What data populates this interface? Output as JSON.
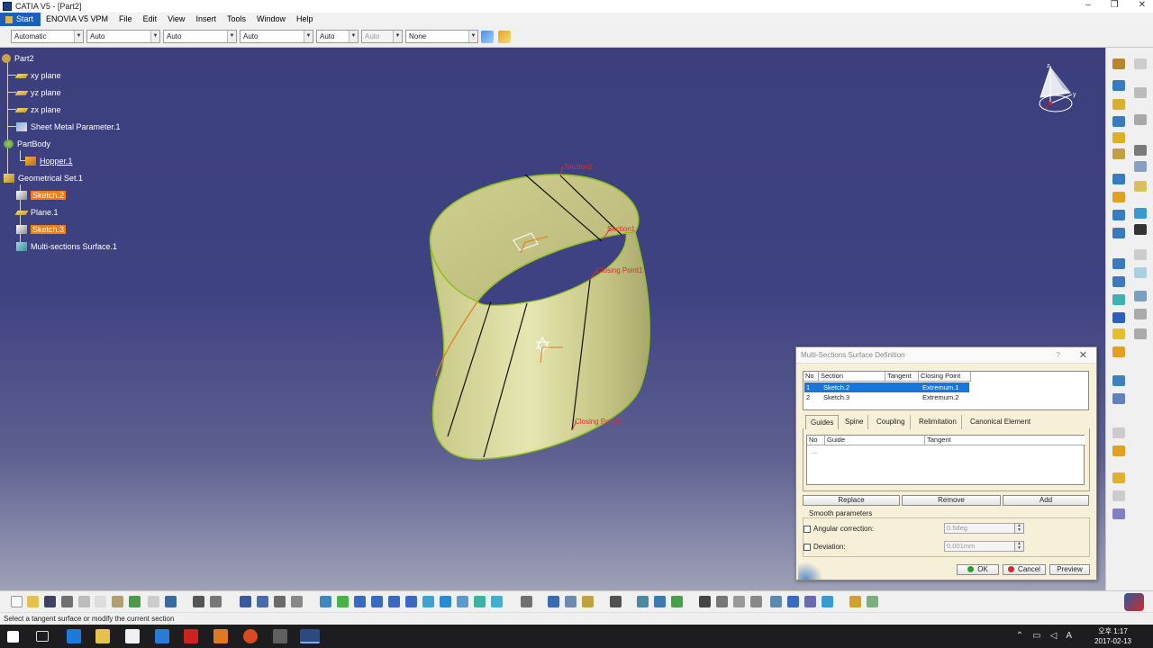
{
  "window": {
    "title": "CATIA V5 - [Part2]",
    "minimize": "–",
    "restore": "❐",
    "close": "✕"
  },
  "menu": [
    "Start",
    "ENOVIA V5 VPM",
    "File",
    "Edit",
    "View",
    "Insert",
    "Tools",
    "Window",
    "Help"
  ],
  "properties": {
    "combo1": "Automatic",
    "combo2": "Auto",
    "combo3": "Auto",
    "combo4": "Auto",
    "combo5": "Auto",
    "combo6": "Auto",
    "combo7": "None"
  },
  "tree": {
    "root": "Part2",
    "xy": "xy plane",
    "yz": "yz plane",
    "zx": "zx plane",
    "sheet": "Sheet Metal Parameter.1",
    "partbody": "PartBody",
    "hopper": "Hopper.1",
    "geoset": "Geometrical Set.1",
    "sketch2": "Sketch.2",
    "plane1": "Plane.1",
    "sketch3": "Sketch.3",
    "surface": "Multi-sections Surface.1"
  },
  "annotations": {
    "section2": "Section2",
    "section1": "Section1",
    "closing1": "Closing Point1",
    "closing2": "Closing Point2"
  },
  "compass": {
    "z": "z",
    "y": "y",
    "x": "x"
  },
  "dialog": {
    "title": "Multi-Sections Surface Definition",
    "help": "?",
    "close": "✕",
    "sections_headers": [
      "No",
      "Section",
      "Tangent",
      "Closing Point"
    ],
    "sections": [
      {
        "no": "1",
        "section": "Sketch.2",
        "closing": "Extremum.1"
      },
      {
        "no": "2",
        "section": "Sketch.3",
        "closing": "Extremum.2"
      }
    ],
    "tabs": [
      "Guides",
      "Spine",
      "Coupling",
      "Relimitation",
      "Canonical Element"
    ],
    "guide_headers": [
      "No",
      "Guide",
      "Tangent"
    ],
    "guide_placeholder": "...",
    "buttons": {
      "replace": "Replace",
      "remove": "Remove",
      "add": "Add"
    },
    "smooth": {
      "label": "Smooth parameters",
      "angular": "Angular correction:",
      "angular_value": "0.5deg",
      "deviation": "Deviation:",
      "deviation_value": "0.001mm"
    },
    "ok": "OK",
    "cancel": "Cancel",
    "preview": "Preview"
  },
  "status": "Select a tangent surface or modify the current section",
  "taskbar": {
    "time": "오후 1:17",
    "date": "2017-02-13"
  },
  "colors": {
    "viewport": "#3c3f7c",
    "highlight": "#f07c1c",
    "surface": "#d8d89a",
    "selection": "#1976d8"
  }
}
